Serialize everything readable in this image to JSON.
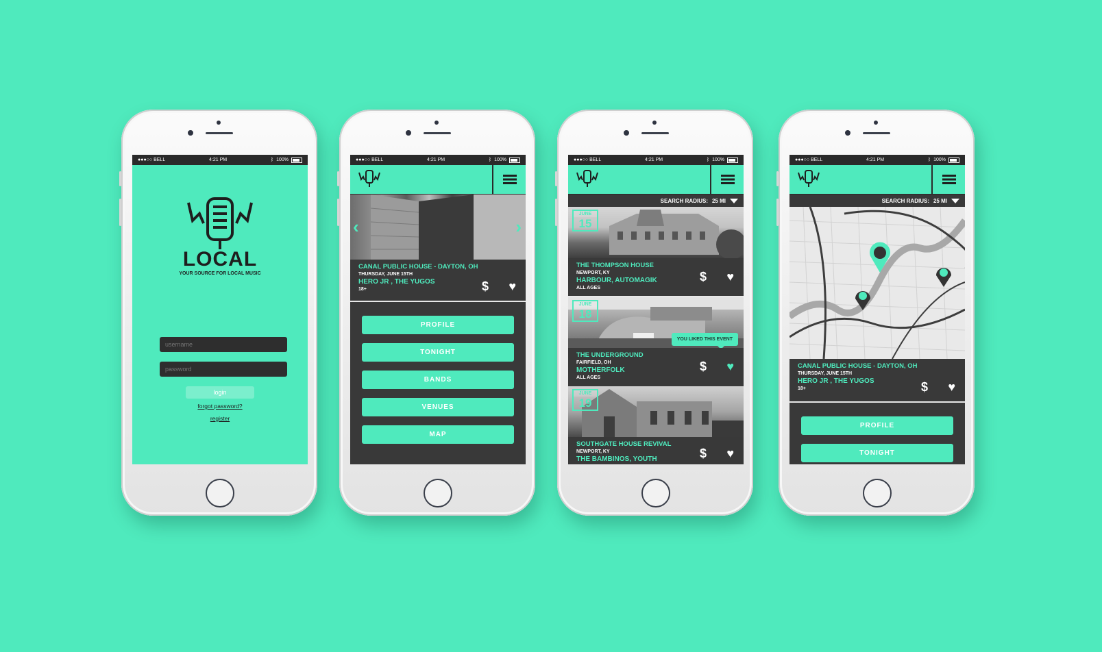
{
  "brand": {
    "accent": "#4feabd",
    "dark": "#393939",
    "background": "#4feabd"
  },
  "status_bar": {
    "carrier": "●●●○○ BELL",
    "time": "4:21 PM",
    "battery": "100%",
    "bluetooth_icon": "bluetooth-icon",
    "wifi_icon": "wifi-icon"
  },
  "login_screen": {
    "app_name": "LOCAL",
    "tagline": "YOUR SOURCE FOR LOCAL MUSIC",
    "username_placeholder": "username",
    "password_placeholder": "password",
    "login_label": "login",
    "forgot_label": "forgot password?",
    "register_label": "register"
  },
  "home_screen": {
    "featured": {
      "venue": "CANAL PUBLIC HOUSE - DAYTON, OH",
      "date": "THURSDAY, JUNE 15TH",
      "bands": "HERO JR , THE YUGOS",
      "age": "18+"
    },
    "menu": [
      "PROFILE",
      "TONIGHT",
      "BANDS",
      "VENUES",
      "MAP"
    ],
    "price_icon": "dollar-icon",
    "like_icon": "heart-icon"
  },
  "events_screen": {
    "search_radius_label": "SEARCH RADIUS:",
    "search_radius_value": "25 MI",
    "events": [
      {
        "month": "JUNE",
        "day": "15",
        "venue": "THE THOMPSON HOUSE",
        "location": "NEWPORT, KY",
        "bands": "HARBOUR, AUTOMAGIK",
        "age": "ALL AGES",
        "liked": false
      },
      {
        "month": "JUNE",
        "day": "18",
        "venue": "THE UNDERGROUND",
        "location": "FAIRFIELD, OH",
        "bands": "MOTHERFOLK",
        "age": "ALL AGES",
        "liked": true
      },
      {
        "month": "JUNE",
        "day": "19",
        "venue": "SOUTHGATE HOUSE REVIVAL",
        "location": "NEWPORT, KY",
        "bands": "THE BAMBINOS, YOUTH",
        "age": "",
        "liked": false
      }
    ],
    "liked_tooltip": "YOU LIKED THIS EVENT"
  },
  "map_screen": {
    "search_radius_label": "SEARCH RADIUS:",
    "search_radius_value": "25 MI",
    "featured": {
      "venue": "CANAL PUBLIC HOUSE - DAYTON, OH",
      "date": "THURSDAY, JUNE 15TH",
      "bands": "HERO JR , THE YUGOS",
      "age": "18+"
    },
    "menu": [
      "PROFILE",
      "TONIGHT"
    ],
    "pin_icon": "map-pin-icon"
  }
}
